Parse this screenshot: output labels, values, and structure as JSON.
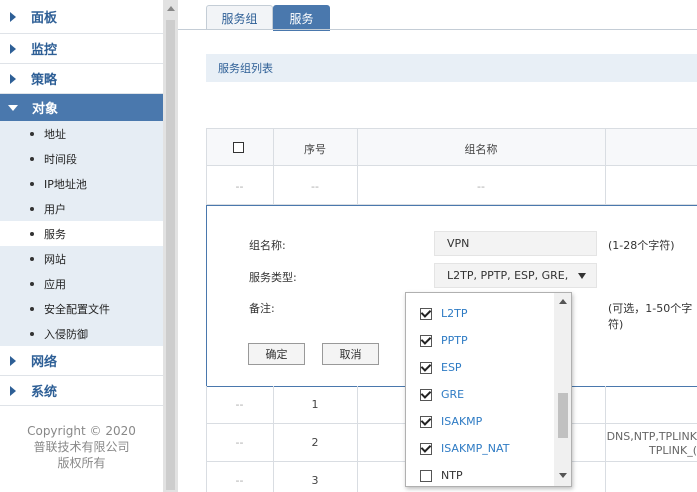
{
  "sidebar": {
    "items": [
      {
        "label": "面板"
      },
      {
        "label": "监控"
      },
      {
        "label": "策略"
      },
      {
        "label": "对象"
      },
      {
        "label": "网络"
      },
      {
        "label": "系统"
      }
    ],
    "sub_items": [
      {
        "label": "地址"
      },
      {
        "label": "时间段"
      },
      {
        "label": "IP地址池"
      },
      {
        "label": "用户"
      },
      {
        "label": "服务"
      },
      {
        "label": "网站"
      },
      {
        "label": "应用"
      },
      {
        "label": "安全配置文件"
      },
      {
        "label": "入侵防御"
      }
    ],
    "copyright": {
      "line1": "Copyright © 2020",
      "line2": "普联技术有限公司",
      "line3": "版权所有"
    }
  },
  "tabs": {
    "service_group": "服务组",
    "service": "服务"
  },
  "section_title": "服务组列表",
  "table": {
    "headers": {
      "index": "序号",
      "name": "组名称"
    },
    "placeholder_row": {
      "index": "--",
      "name": "--",
      "check": "--"
    },
    "rows": [
      {
        "check": "--",
        "index": "1"
      },
      {
        "check": "--",
        "index": "2",
        "extra_line1": "DNS,NTP,TPLINK",
        "extra_line2": "TPLINK_("
      },
      {
        "check": "--",
        "index": "3"
      }
    ]
  },
  "form": {
    "name_label": "组名称:",
    "name_value": "VPN",
    "name_hint": "(1-28个字符)",
    "type_label": "服务类型:",
    "type_value": "L2TP, PPTP, ESP, GRE,",
    "note_label": "备注:",
    "note_hint": "(可选，1-50个字符)",
    "ok_button": "确定",
    "cancel_button": "取消"
  },
  "dropdown": {
    "options": [
      {
        "label": "L2TP",
        "checked": true
      },
      {
        "label": "PPTP",
        "checked": true
      },
      {
        "label": "ESP",
        "checked": true
      },
      {
        "label": "GRE",
        "checked": true
      },
      {
        "label": "ISAKMP",
        "checked": true
      },
      {
        "label": "ISAKMP_NAT",
        "checked": true
      },
      {
        "label": "NTP",
        "checked": false
      }
    ]
  },
  "colors": {
    "accent": "#4a78ad",
    "accent_text": "#2e5f96",
    "checked_text": "#2e7bc4"
  }
}
